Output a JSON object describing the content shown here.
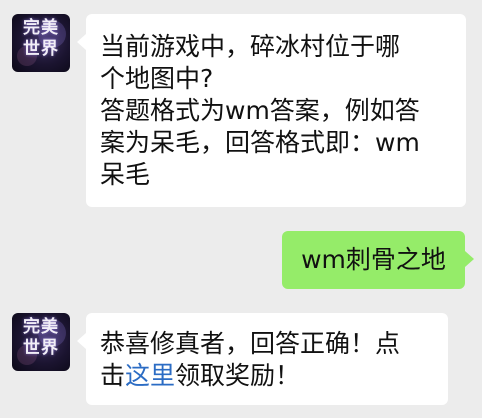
{
  "messages": [
    {
      "sender": "game-account",
      "avatar_logo_top": "完美",
      "avatar_logo_bottom": "世界",
      "lines": [
        "当前游戏中，碎冰村位于哪",
        "个地图中?",
        "答题格式为wm答案，例如答",
        "案为呆毛，回答格式即：wm",
        "呆毛"
      ]
    },
    {
      "sender": "user",
      "text": "wm刺骨之地"
    },
    {
      "sender": "game-account",
      "avatar_logo_top": "完美",
      "avatar_logo_bottom": "世界",
      "line1": "恭喜修真者，回答正确！点",
      "line2_prefix": "击",
      "link_text": "这里",
      "line2_suffix": "领取奖励！"
    }
  ],
  "colors": {
    "background": "#ececec",
    "incoming_bubble": "#ffffff",
    "outgoing_bubble": "#95ec69",
    "link": "#2b6cc4"
  }
}
